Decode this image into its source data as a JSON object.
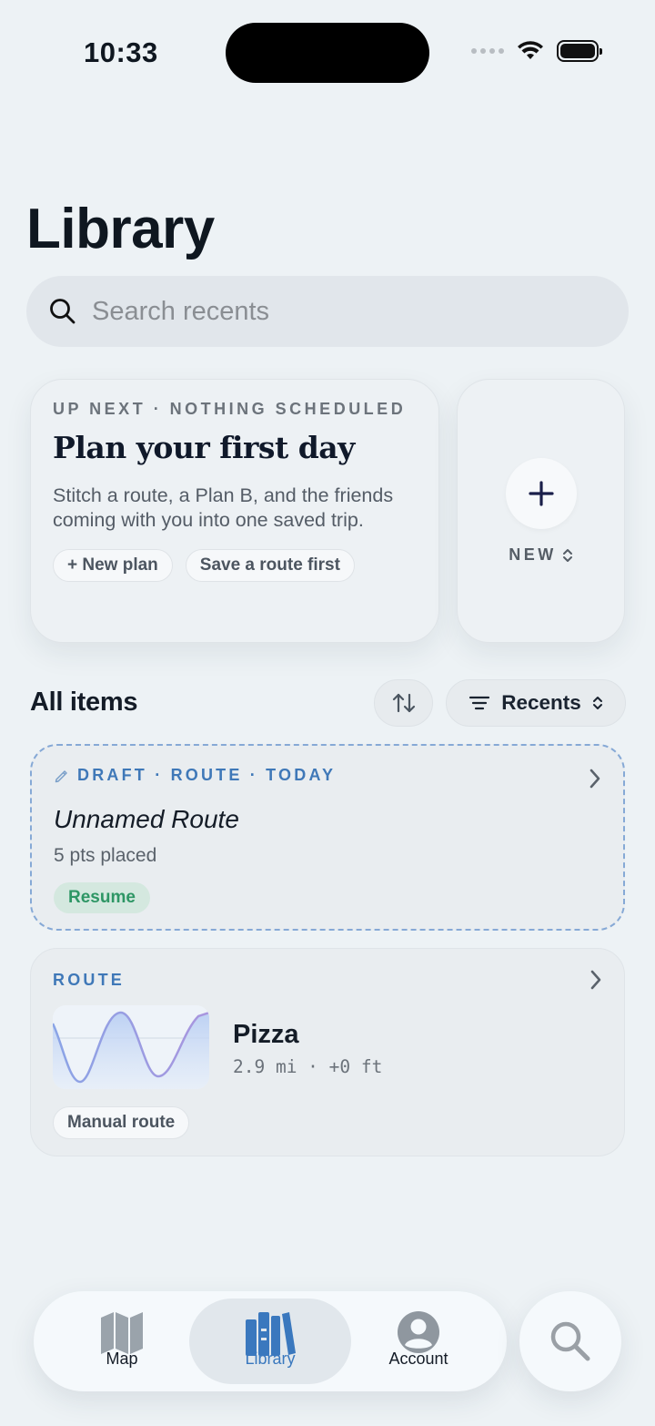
{
  "status_bar": {
    "time": "10:33"
  },
  "page": {
    "title": "Library"
  },
  "search": {
    "placeholder": "Search recents"
  },
  "up_next": {
    "eyebrow": "UP NEXT · NOTHING SCHEDULED",
    "title": "Plan your first day",
    "body": "Stitch a route, a Plan B, and the friends coming with you into one saved trip.",
    "actions": [
      "+ New plan",
      "Save a route first"
    ]
  },
  "new_card": {
    "label": "NEW"
  },
  "items_section": {
    "title": "All items",
    "filter_label": "Recents"
  },
  "items": [
    {
      "kind": "draft",
      "eyebrow": "DRAFT · ROUTE · TODAY",
      "title": "Unnamed Route",
      "subtitle": "5 pts placed",
      "action": "Resume"
    },
    {
      "kind": "route",
      "eyebrow": "ROUTE",
      "title": "Pizza",
      "meta": "2.9 mi · +0 ft",
      "tag": "Manual route"
    }
  ],
  "tab_bar": {
    "tabs": [
      {
        "label": "Map",
        "icon": "map-icon",
        "active": false
      },
      {
        "label": "Library",
        "icon": "library-icon",
        "active": true
      },
      {
        "label": "Account",
        "icon": "account-icon",
        "active": false
      }
    ],
    "search_icon": "search-icon"
  },
  "colors": {
    "background": "#edf2f5",
    "accent_blue": "#3f78b8",
    "resume_green": "#2e9665",
    "resume_bg": "#d4e8df"
  }
}
